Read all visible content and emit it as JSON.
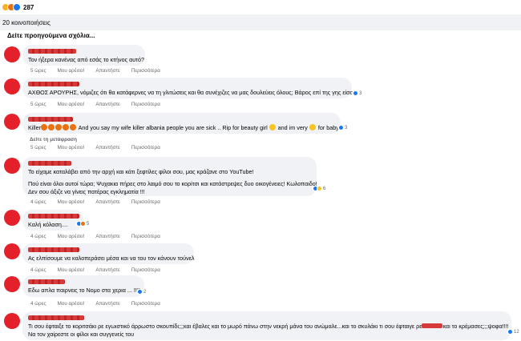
{
  "reactions": {
    "count": "287",
    "icons": [
      "haha-icon",
      "angry-icon",
      "like-icon"
    ]
  },
  "shares": {
    "label": "20 κοινοποιήσεις"
  },
  "prev_comments": {
    "label": "Δείτε προηγούμενα σχόλια..."
  },
  "actions": {
    "like": "Μου αρέσει!",
    "reply": "Απαντήστε",
    "more": "Περισσότερα",
    "translate": "Δείτε τη μετάφραση"
  },
  "colors": {
    "avatar": "#e4212b",
    "bubble": "#f0f2f5",
    "meta": "#65676b",
    "like": "#1877f2"
  },
  "comments": [
    {
      "text": [
        "Τον ήξερα κανένας από εσάς το κτήνος αυτό?"
      ],
      "time": "5 ώρες",
      "reacts": ""
    },
    {
      "text": [
        "ΑΧΘΟΣ ΑΡΟΥΡΗΣ, νόμιζες ότι θα κατάφερνες να τη γλιτώσεις και θα συνέχιζες να μας δουλεύεις όλους; Βάρος επί της γης είσαι"
      ],
      "time": "5 ώρες",
      "reacts": "3"
    },
    {
      "text_a": "Killer",
      "text_b": " And you say my wife killer albania people you are sick .. Rip for beauty girl ",
      "text_c": " and im very ",
      "text_d": " for baby.",
      "time": "5 ώρες",
      "reacts": "3"
    },
    {
      "text": [
        "Το είχαμε καταλάβει από την αρχή και κάτι ξεφτίλες φίλοι σου, μας κράζανε στο YouTube!",
        "",
        "Πού είναι όλοι αυτοί τώρα; Ψυχακια πήρες στο λαιμό σου το κορίτσι και κατάστρεψες δυο οικογένειες! Κωλοπαιδο!",
        "Δεν σου άξιζε να γίνεις πατέρας εγκληματία !!!"
      ],
      "time": "4 ώρες",
      "reacts": "6"
    },
    {
      "text": [
        "Καλή κόλαση...."
      ],
      "time": "4 ώρες",
      "reacts": "5"
    },
    {
      "text": [
        "Ας ελπίσουμε να καλοπεράσει μέσα και να του τον κάνουν τούνελ"
      ],
      "time": "4 ώρες",
      "reacts": ""
    },
    {
      "text": [
        "Εδω απλα παιρνεις το Νομο στα χερια ... !!!!"
      ],
      "time": "4 ώρες",
      "reacts": "2"
    },
    {
      "text_a": "Τι σου έφταιξε το κοριτσάκι ρε εγωιστικό άρρωστο σκουπίδι;;;και έβαλες και το μωρό πάνω στην νεκρή μάνα του ανώμαλε...και το σκυλάκι τι σου έφταιγε ρε",
      "text_b": "και το κρέμασες;;;ψοφα!!!!",
      "text_c": "Να τον χαίρεστε οι φίλοι και συγγενείς του",
      "time": "4 ώρες",
      "reacts": "12"
    }
  ]
}
